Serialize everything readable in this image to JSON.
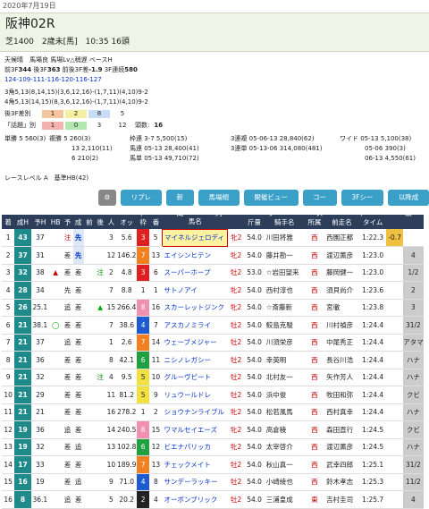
{
  "date": "2020年7月19日",
  "race": {
    "title": "阪神02R",
    "subtitle": "芝1400　2歳未[馬]　10:35 16頭"
  },
  "cond": {
    "line1": "天候晴　馬場良 馬場Lv△稍遅 ベースH",
    "line2a": "前3F",
    "line2b": "344",
    "line2c": " 後3F",
    "line2d": "363",
    "line2e": " 前後3F差",
    "line2f": "-1.9",
    "line2g": " 3F連続",
    "line2h": "580"
  },
  "laps": "124-109-111-116-120-116-127",
  "corners": [
    "3角5,13(8,14,15)(3,6,12,16)-(1,7,11)(4,10)9-2",
    "4角5,13(14,15)(8,3,6,12,16)-(1,7,11)(4,10)9-2"
  ],
  "boxes1": {
    "label": "後3F差別",
    "v1": "1",
    "v2": "2",
    "v3": "8",
    "v4": "5"
  },
  "boxes2": {
    "label": "「話題」別",
    "v1": "1",
    "v2": "0",
    "v3": "3",
    "v4": "12",
    "v5": "頭数:",
    "v6": "16"
  },
  "odds": {
    "tansho": "単勝 5 560(3)",
    "fukusho_l": "複勝 5",
    "fukusho_v1": "260(3)",
    "f2l": "13",
    "f2v": "2,110(11)",
    "f3l": "6",
    "f3v": "210(2)",
    "wakuren": "枠連 3-7",
    "wakuren_v": "5,500(15)",
    "umaren": "馬連 05-13",
    "umaren_v": "28,400(41)",
    "umatan": "馬単 05-13",
    "umatan_v": "49,710(72)",
    "sanrenpuku": "3連複 05-06-13",
    "sanrenpuku_v": "28,840(62)",
    "sanrentan": "3連単 05-13-06",
    "sanrentan_v": "314,080(481)",
    "wide1": "ワイド 05-13",
    "wide1_v": "5,100(38)",
    "wide2": "05-06",
    "wide2_v": "390(3)",
    "wide3": "06-13",
    "wide3_v": "4,550(61)"
  },
  "filter": {
    "label": "レースレベル A　基準HB(42)"
  },
  "buttons": [
    "リプレイ",
    "新聞",
    "馬場傾向",
    "開催ビューワ",
    "コース",
    "3Fシート",
    "以降成績"
  ],
  "table": {
    "headers": [
      "着",
      "成H",
      "予H",
      "HB",
      "予",
      "成",
      "前",
      "後",
      "人",
      "オッ",
      "枠",
      "番",
      "馬名",
      "",
      "斤量",
      "騎手名",
      "所属",
      "前走名",
      "タイム",
      "",
      ""
    ],
    "rows": [
      [
        "1",
        "43",
        "37",
        "",
        "注",
        "先",
        "",
        "",
        "3",
        "5.6",
        "3",
        "5",
        "マイネルジェロディ",
        "牝2",
        "54.0",
        "川田将雅",
        "西",
        "西園正都",
        "1:22.3",
        "-0.7",
        ""
      ],
      [
        "2",
        "37",
        "31",
        "",
        "差",
        "先",
        "",
        "",
        "12",
        "146.2",
        "7",
        "13",
        "エイシンヒテン",
        "牝2",
        "54.0",
        "藤井勘一",
        "西",
        "渡辺薫彦",
        "1:23.0",
        "",
        "4"
      ],
      [
        "3",
        "32",
        "38",
        "▲",
        "差",
        "差",
        "",
        "注",
        "2",
        "4.8",
        "3",
        "6",
        "スーパーホープ",
        "牡2",
        "53.0",
        "☆岩田望来",
        "西",
        "藤岡健一",
        "1:23.0",
        "",
        "1/2"
      ],
      [
        "4",
        "28",
        "34",
        "",
        "先",
        "差",
        "",
        "",
        "7",
        "8.8",
        "1",
        "1",
        "サトノアイ",
        "牝2",
        "54.0",
        "西村淳也",
        "西",
        "須貝尚介",
        "1:23.6",
        "",
        "2"
      ],
      [
        "5",
        "26",
        "25.1",
        "",
        "追",
        "差",
        "",
        "▲",
        "15",
        "266.4",
        "8",
        "16",
        "スカーレットジンク",
        "牝2",
        "54.0",
        "☆斎藤新",
        "西",
        "宮徹",
        "1:23.8",
        "",
        "3"
      ],
      [
        "6",
        "21",
        "38.1",
        "◯",
        "差",
        "差",
        "",
        "",
        "7",
        "38.6",
        "4",
        "7",
        "アスカノミライ",
        "牡2",
        "54.0",
        "鮫島克駿",
        "西",
        "川村禎彦",
        "1:24.4",
        "",
        "31/2"
      ],
      [
        "7",
        "21",
        "37",
        "",
        "追",
        "差",
        "",
        "",
        "1",
        "2.6",
        "7",
        "14",
        "ウェーブメジャー",
        "牡2",
        "54.0",
        "川須栄彦",
        "西",
        "中尾秀正",
        "1:24.4",
        "",
        "アタマ"
      ],
      [
        "8",
        "21",
        "36",
        "",
        "差",
        "差",
        "",
        "",
        "8",
        "42.1",
        "6",
        "11",
        "ニシノレガシー",
        "牡2",
        "54.0",
        "幸英明",
        "西",
        "長谷川浩",
        "1:24.4",
        "",
        "ハナ"
      ],
      [
        "9",
        "21",
        "32",
        "",
        "差",
        "差",
        "",
        "注",
        "4",
        "9.5",
        "5",
        "10",
        "グルーヴピート",
        "牡2",
        "54.0",
        "北村友一",
        "西",
        "矢作芳人",
        "1:24.4",
        "",
        "ハナ"
      ],
      [
        "10",
        "21",
        "29",
        "",
        "差",
        "差",
        "",
        "",
        "11",
        "81.2",
        "5",
        "9",
        "リュウールドレ",
        "牡2",
        "54.0",
        "浜中俊",
        "西",
        "牧田和弥",
        "1:24.4",
        "",
        "クビ"
      ],
      [
        "11",
        "21",
        "21",
        "",
        "差",
        "差",
        "",
        "",
        "16",
        "278.2",
        "1",
        "2",
        "ショウナンライブル",
        "牝2",
        "54.0",
        "松若風馬",
        "西",
        "西村真幸",
        "1:24.4",
        "",
        "ハナ"
      ],
      [
        "12",
        "19",
        "36",
        "",
        "追",
        "差",
        "",
        "",
        "14",
        "240.5",
        "8",
        "15",
        "ワマルセイエーズ",
        "牝2",
        "54.0",
        "高倉稜",
        "西",
        "森田直行",
        "1:24.5",
        "",
        "クビ"
      ],
      [
        "13",
        "19",
        "32",
        "",
        "差",
        "追",
        "",
        "",
        "13",
        "102.8",
        "6",
        "12",
        "ビエナパリッカ",
        "牝2",
        "54.0",
        "太宰啓介",
        "西",
        "渡辺薫彦",
        "1:24.5",
        "",
        "ハナ"
      ],
      [
        "14",
        "17",
        "33",
        "",
        "差",
        "差",
        "",
        "",
        "10",
        "189.9",
        "7",
        "13",
        "チェックメイト",
        "牡2",
        "54.0",
        "秋山真一",
        "西",
        "武幸四郎",
        "1:25.1",
        "",
        "31/2"
      ],
      [
        "15",
        "16",
        "19",
        "",
        "差",
        "追",
        "",
        "",
        "9",
        "71.0",
        "4",
        "8",
        "サンデーラッキー",
        "牡2",
        "54.0",
        "小崎綾也",
        "西",
        "鈴木孝志",
        "1:25.3",
        "",
        "11/2"
      ],
      [
        "16",
        "8",
        "36.1",
        "",
        "追",
        "差",
        "",
        "",
        "5",
        "20.2",
        "2",
        "4",
        "オーボンブリック",
        "牡2",
        "54.0",
        "三浦皇成",
        "東",
        "吉村圭司",
        "1:25.7",
        "",
        "4"
      ]
    ]
  },
  "frame_colors": {
    "1": "#ffffff",
    "2": "#222222",
    "3": "#e02020",
    "4": "#1e5ad0",
    "5": "#f0e040",
    "6": "#20a040",
    "7": "#f08020",
    "8": "#f090b0"
  }
}
